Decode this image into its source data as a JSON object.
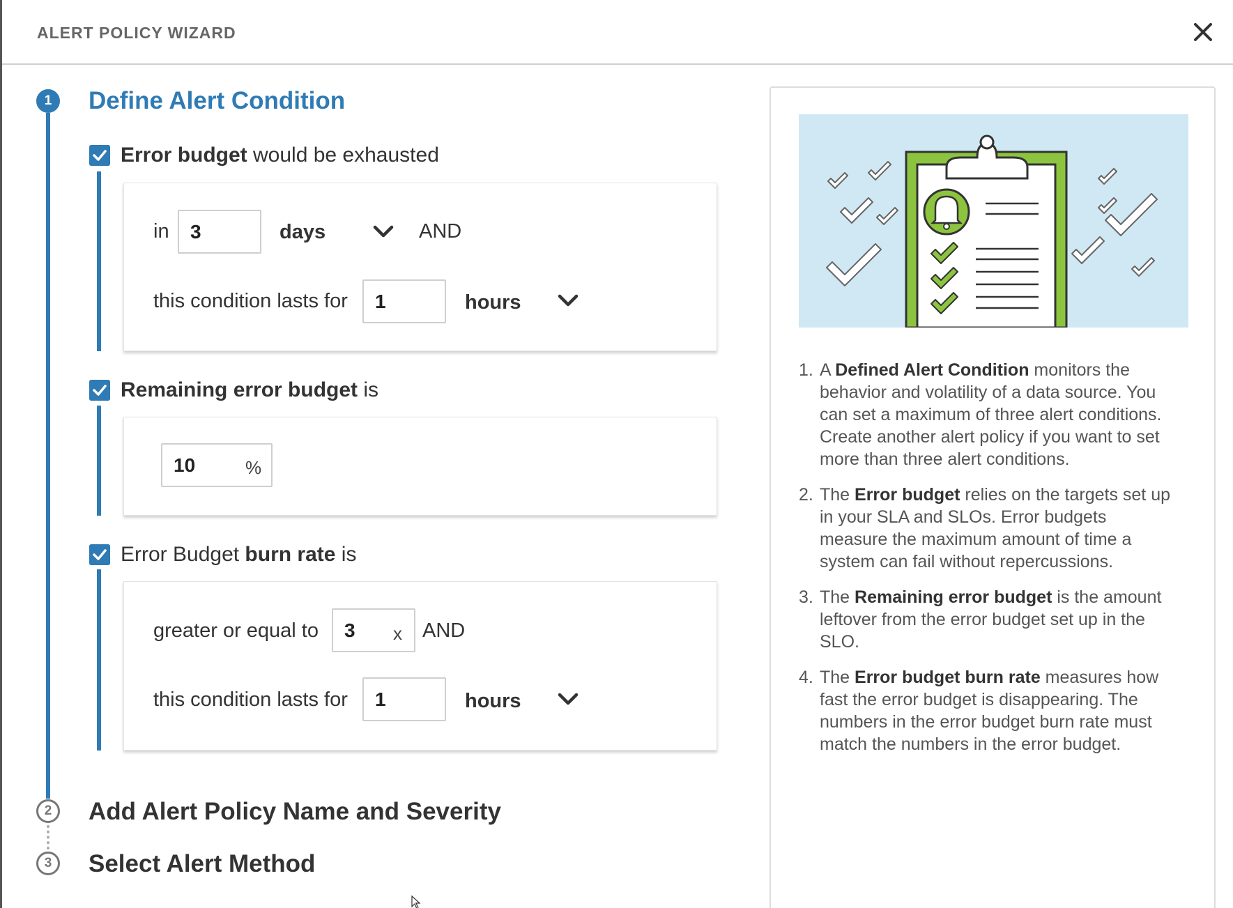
{
  "header": {
    "title": "ALERT POLICY WIZARD"
  },
  "steps": [
    {
      "number": "1",
      "title": "Define Alert Condition",
      "active": true
    },
    {
      "number": "2",
      "title": "Add Alert Policy Name and Severity",
      "active": false
    },
    {
      "number": "3",
      "title": "Select Alert Method",
      "active": false
    }
  ],
  "conditions": {
    "exhausted": {
      "checked": true,
      "label_bold": "Error budget",
      "label_rest": " would be exhausted",
      "in_label": "in",
      "days_value": "3",
      "days_unit": "days",
      "and_label": "AND",
      "lasts_label": "this condition lasts for",
      "hours_value": "1",
      "hours_unit": "hours"
    },
    "remaining": {
      "checked": true,
      "label_bold": "Remaining error budget",
      "label_rest": " is",
      "percent_value": "10",
      "percent_suffix": "%"
    },
    "burn_rate": {
      "checked": true,
      "label_pre": "Error Budget ",
      "label_bold": "burn rate",
      "label_rest": " is",
      "gte_label": "greater or equal to",
      "rate_value": "3",
      "rate_suffix": "x",
      "and_label": "AND",
      "lasts_label": "this condition lasts for",
      "hours_value": "1",
      "hours_unit": "hours"
    }
  },
  "help": {
    "items": [
      {
        "num": "1.",
        "pre": "A ",
        "bold": "Defined Alert Condition",
        "post": " monitors the behavior and volatility of a data source. You can set a maximum of three alert conditions. Create another alert policy if you want to set more than three alert conditions."
      },
      {
        "num": "2.",
        "pre": "The ",
        "bold": "Error budget",
        "post": " relies on the targets set up in your SLA and SLOs. Error budgets measure the maximum amount of time a system can fail without repercussions."
      },
      {
        "num": "3.",
        "pre": "The ",
        "bold": "Remaining error budget",
        "post": " is the amount leftover from the error budget set up in the SLO."
      },
      {
        "num": "4.",
        "pre": "The ",
        "bold": "Error budget burn rate",
        "post": " measures how fast the error budget is disappearing. The numbers in the error budget burn rate must match the numbers in the error budget."
      }
    ]
  },
  "colors": {
    "accent": "#2f7bb5",
    "illustration_bg": "#cfe8f3",
    "clipboard_green": "#8cc43f"
  },
  "icons": {
    "close": "close-icon",
    "chevron": "chevron-down-icon",
    "checkbox": "checkbox-checked-icon",
    "illustration": "clipboard-checklist-illustration"
  }
}
